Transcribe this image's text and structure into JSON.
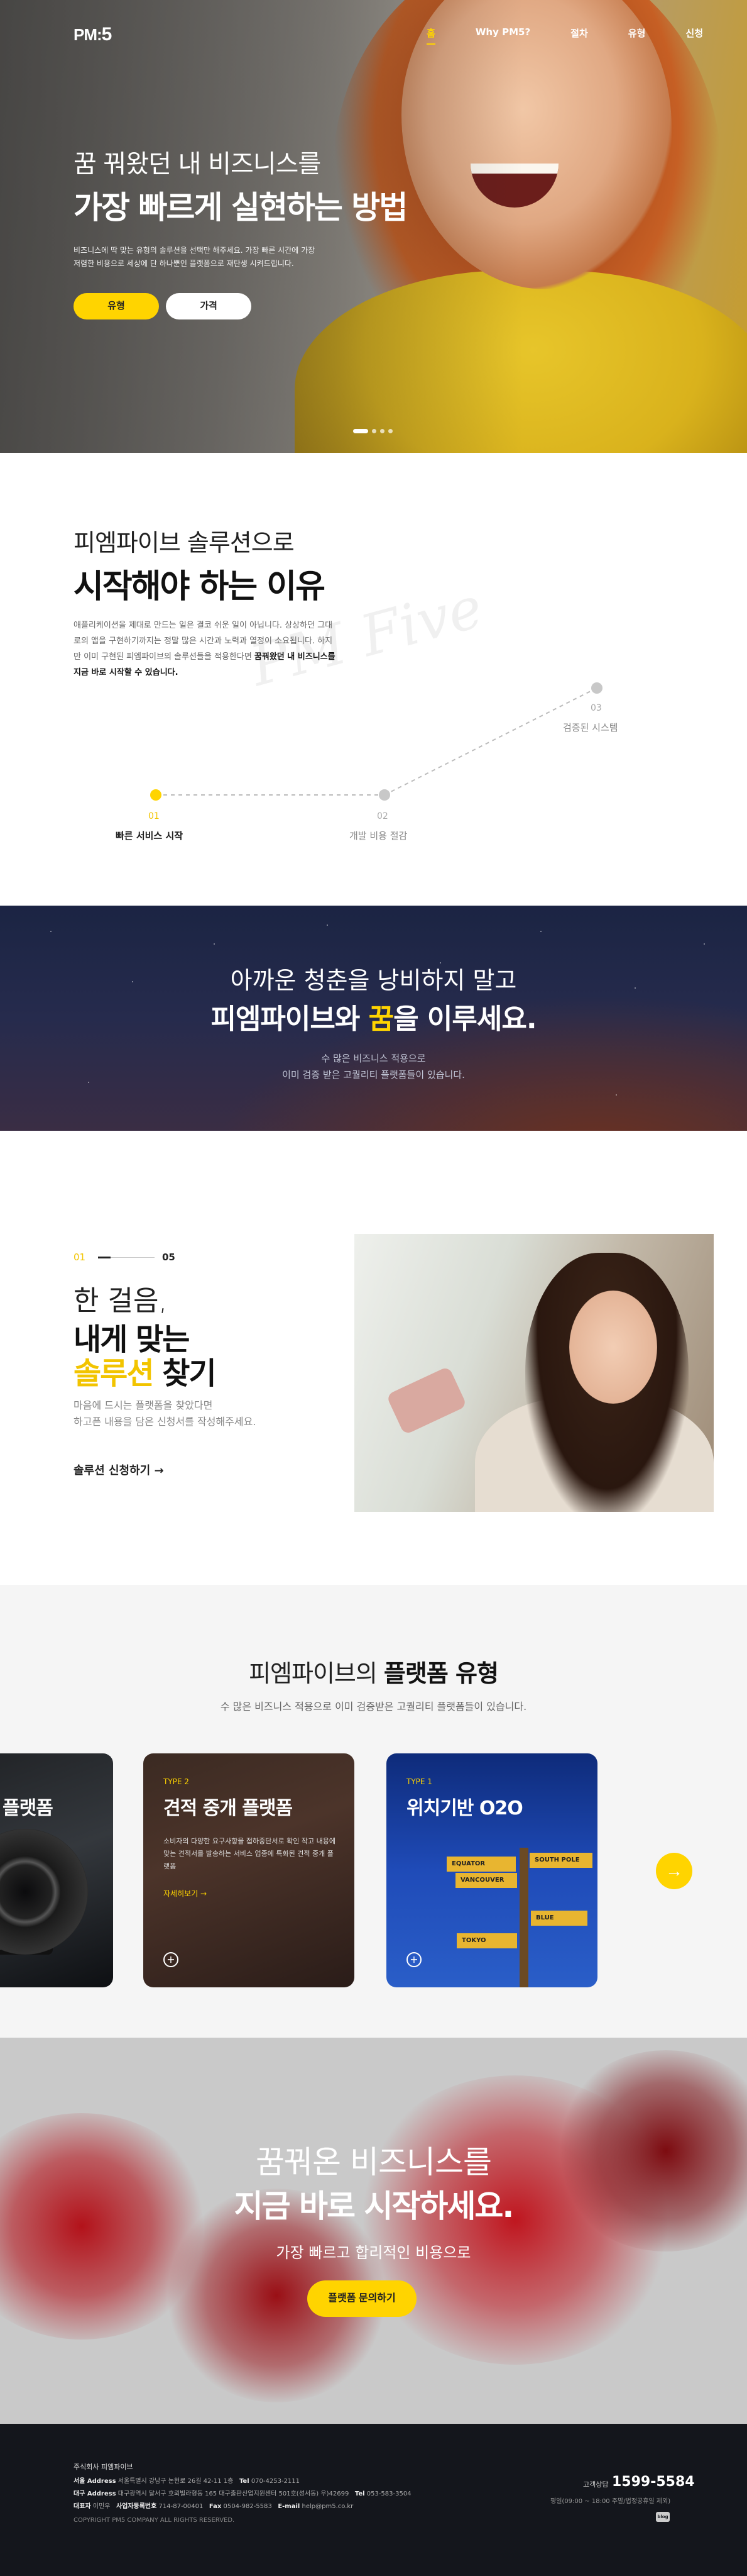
{
  "brand": {
    "logo_prefix": "PM",
    "logo_suffix": "5"
  },
  "nav": {
    "items": [
      "홈",
      "Why PM5?",
      "절차",
      "유형",
      "신청"
    ],
    "active": "홈"
  },
  "hero": {
    "subtitle": "꿈 꿔왔던 내 비즈니스를",
    "title": "가장 빠르게 실현하는 방법",
    "desc_line1": "비즈니스에 딱 맞는 유형의 솔루션을 선택만 해주세요. 가장 빠른 시간에 가장",
    "desc_line2": "저렴한 비용으로 세상에 단 하나뿐인 플랫폼으로 재탄생 시켜드립니다.",
    "btn_type": "유형",
    "btn_price": "가격"
  },
  "why": {
    "subtitle": "피엠파이브 솔루션으로",
    "title": "시작해야 하는 이유",
    "desc_1": "애플리케이션을 제대로 만드는 일은 결코 쉬운 일이 아닙니다. 상상하던 그대로의 앱을 구현하기까지는 정말 많은 시간과 노력과 열정이 소요됩니다. 하지만 이미 구현된 피엠파이브의 솔루션들을 적용한다면 ",
    "desc_bold": "꿈꿔왔던 내 비즈니스를 지금 바로 시작할 수 있습니다.",
    "signature": "PM Five",
    "steps": [
      {
        "num": "01",
        "label": "빠른 서비스 시작"
      },
      {
        "num": "02",
        "label": "개발 비용 절감"
      },
      {
        "num": "03",
        "label": "검증된 시스템"
      }
    ]
  },
  "youth": {
    "line1": "아까운 청춘을 낭비하지 말고",
    "line2_a": "피엠파이브와 ",
    "line2_hl": "꿈",
    "line2_b": "을 이루세요.",
    "line3_1": "수 많은 비즈니스 적용으로",
    "line3_2": "이미 검증 받은 고퀄리티 플랫폼들이 있습니다."
  },
  "step": {
    "page_current": "01",
    "page_total": "05",
    "t1": "한 걸음,",
    "t2": "내게 맞는",
    "t3_hl": "솔루션",
    "t3_b": " 찾기",
    "desc_1": "마음에 드시는 플랫폼을 찾았다면",
    "desc_2": "하고픈 내용을 담은 신청서를 작성해주세요.",
    "link": "솔루션 신청하기 →"
  },
  "platform": {
    "title_a": "피엠파이브의 ",
    "title_b": "플랫폼 유형",
    "subtitle": "수 많은 비즈니스 적용으로 이미 검증받은 고퀄리티 플랫폼들이 있습니다.",
    "cards": [
      {
        "type": "",
        "name": "플랫폼",
        "desc": "",
        "more": ""
      },
      {
        "type": "TYPE 2",
        "name": "견적 중개 플랫폼",
        "desc": "소비자의 다양한 요구사항을 접하중단서로 확인 작고 내용에 맞는 견적서를 발송하는 서비스 업종에 특화된 견적 중개 플랫폼",
        "more": "자세히보기 →"
      },
      {
        "type": "TYPE 1",
        "name": "위치기반 O2O",
        "desc": "",
        "more": ""
      }
    ],
    "signs": [
      "EQUATOR",
      "VANCOUVER",
      "SOUTH POLE",
      "BLUE",
      "TOKYO"
    ],
    "next_button": "→",
    "plus": "+"
  },
  "cta": {
    "line1": "꿈꿔온 비즈니스를",
    "line2": "지금 바로 시작하세요.",
    "line3": "가장 빠르고 합리적인 비용으로",
    "button": "플랫폼 문의하기"
  },
  "footer": {
    "company": "주식회사 피엠파이브",
    "seoul_label": "서울 Address",
    "seoul": " 서울특별시 강남구 논현로 26길 42-11 1층",
    "seoul_tel_label": "Tel",
    "seoul_tel": " 070-4253-2111",
    "daegu_label": "대구 Address",
    "daegu": " 대구광역시 달서구 호뢰빌라형동 165 대구출판산업지원센터 501호(성서동) 우)42699",
    "daegu_tel_label": "Tel",
    "daegu_tel": " 053-583-3504",
    "ceo_label": "대표자",
    "ceo": " 이민우",
    "biz_label": "사업자등록번호",
    "biz": " 714-87-00401",
    "fax_label": "Fax",
    "fax": " 0504-982-5583",
    "email_label": "E-mail",
    "email": " help@pm5.co.kr",
    "copyright": "COPYRIGHT PM5 COMPANY ALL RIGHTS RESERVED.",
    "tel_label": "고객상담",
    "tel": "1599-5584",
    "hours": "평일(09:00 ~ 18:00 주말/법정공휴일 제외)",
    "blog": "blog"
  }
}
